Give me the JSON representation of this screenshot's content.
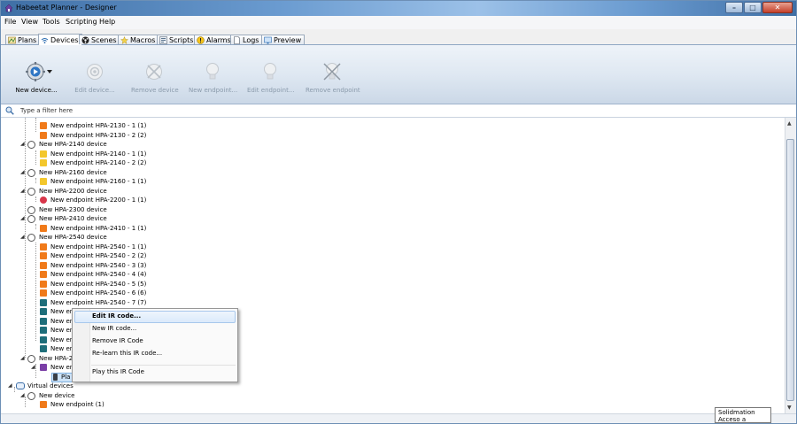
{
  "window": {
    "title": "Habeetat Planner - Designer",
    "controls": {
      "minimize": "–",
      "maximize": "□",
      "close": "✕"
    }
  },
  "menu": [
    "File",
    "View",
    "Tools",
    "Scripting",
    "Help"
  ],
  "tabs": [
    {
      "label": "Plans",
      "icon": "plans-icon"
    },
    {
      "label": "Devices",
      "icon": "wifi-icon"
    },
    {
      "label": "Scenes",
      "icon": "scenes-icon"
    },
    {
      "label": "Macros",
      "icon": "macros-icon"
    },
    {
      "label": "Scripts",
      "icon": "scripts-icon"
    },
    {
      "label": "Alarms",
      "icon": "alarms-icon"
    },
    {
      "label": "Logs",
      "icon": "logs-icon"
    },
    {
      "label": "Preview",
      "icon": "preview-icon"
    }
  ],
  "active_tab": "Devices",
  "toolbar": {
    "new_device": "New device...",
    "edit_device": "Edit device...",
    "remove_device": "Remove device",
    "new_endpoint": "New endpoint...",
    "edit_endpoint": "Edit endpoint...",
    "remove_endpoint": "Remove endpoint"
  },
  "filter": {
    "placeholder": "Type a filter here"
  },
  "tree": {
    "rows": [
      "New endpoint HPA-2130 - 1 (1)",
      "New endpoint HPA-2130 - 2 (2)",
      "New HPA-2140 device",
      "New endpoint HPA-2140 - 1 (1)",
      "New endpoint HPA-2140 - 2 (2)",
      "New HPA-2160 device",
      "New endpoint HPA-2160 - 1 (1)",
      "New HPA-2200 device",
      "New endpoint HPA-2200 - 1 (1)",
      "New HPA-2300 device",
      "New HPA-2410 device",
      "New endpoint HPA-2410 - 1 (1)",
      "New HPA-2540 device",
      "New endpoint HPA-2540 - 1 (1)",
      "New endpoint HPA-2540 - 2 (2)",
      "New endpoint HPA-2540 - 3 (3)",
      "New endpoint HPA-2540 - 4 (4)",
      "New endpoint HPA-2540 - 5 (5)",
      "New endpoint HPA-2540 - 6 (6)",
      "New endpoint HPA-2540 - 7 (7)",
      "New en",
      "New en",
      "New en",
      "New en",
      "New en",
      "New HPA-2",
      "New en",
      "Pla",
      "Virtual devices",
      "New device",
      "New endpoint (1)"
    ]
  },
  "context_menu": {
    "items": [
      "Edit IR code...",
      "New IR code...",
      "Remove IR Code",
      "Re-learn this IR code...",
      "Play this IR Code"
    ]
  },
  "tooltip": {
    "line1": "Solidmation",
    "line2": "Acceso a Internet"
  },
  "colors": {
    "accent": "#3c7fc8",
    "orange": "#f07a1a",
    "yellow": "#f3c72c",
    "teal": "#1e6e7a",
    "purple": "#7a3ea6",
    "red": "#d8364a"
  }
}
